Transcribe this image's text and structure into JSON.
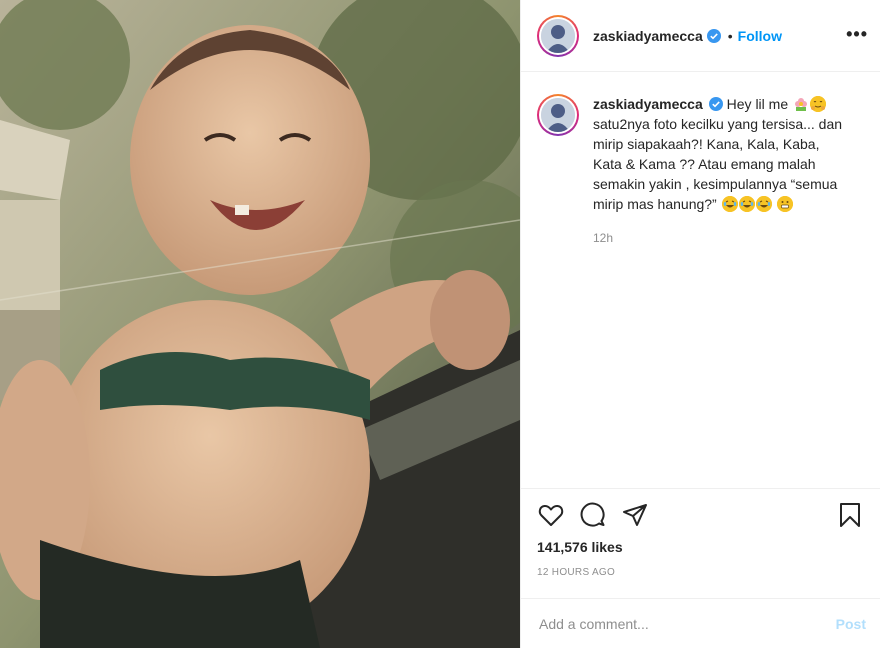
{
  "post": {
    "image_alt": "Vintage photo of a smiling baby",
    "author": "zaskiadyamecca",
    "verified": true,
    "separator": "•",
    "follow_label": "Follow",
    "more_label": "•••"
  },
  "caption": {
    "username": "zaskiadyamecca",
    "text_start": "Hey lil me",
    "text_body": "satu2nya foto kecilku yang tersisa... dan mirip siapakaah?! Kana, Kala, Kaba, Kata & Kama ?? Atau emang malah semakin yakin , kesimpulannya “semua mirip mas hanung?”",
    "time": "12h"
  },
  "actions": {
    "likes": "141,576 likes",
    "timestamp": "12 HOURS AGO"
  },
  "comment": {
    "placeholder": "Add a comment...",
    "post_label": "Post"
  },
  "colors": {
    "accent": "#0095f6",
    "post_disabled": "#b2dffc",
    "muted": "#8e8e8e",
    "verified": "#3897f0"
  },
  "icons": [
    "heart-icon",
    "comment-icon",
    "share-icon",
    "bookmark-icon",
    "verified-icon",
    "more-icon"
  ]
}
